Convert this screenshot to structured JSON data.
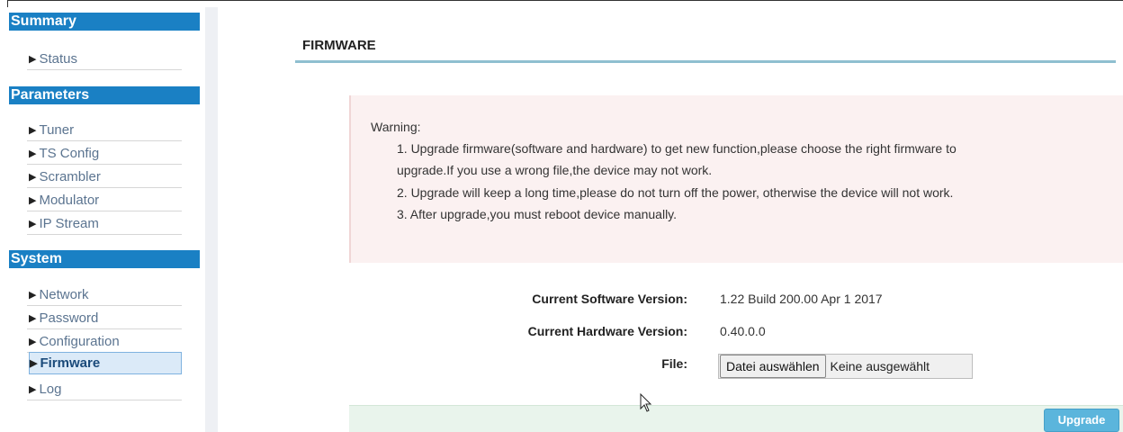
{
  "sidebar": {
    "sections": [
      {
        "title": "Summary",
        "items": [
          {
            "label": "Status"
          }
        ]
      },
      {
        "title": "Parameters",
        "items": [
          {
            "label": "Tuner"
          },
          {
            "label": "TS Config"
          },
          {
            "label": "Scrambler"
          },
          {
            "label": "Modulator"
          },
          {
            "label": "IP Stream"
          }
        ]
      },
      {
        "title": "System",
        "items": [
          {
            "label": "Network"
          },
          {
            "label": "Password"
          },
          {
            "label": "Configuration"
          },
          {
            "label": "Firmware",
            "active": true
          },
          {
            "label": "Log"
          }
        ]
      }
    ]
  },
  "main": {
    "title": "FIRMWARE",
    "warning": {
      "heading": "Warning:",
      "lines": [
        "1. Upgrade firmware(software and hardware) to get new function,please choose the right firmware to",
        "upgrade.If you use a wrong file,the device may not work.",
        "2. Upgrade will keep a long time,please do not turn off the power, otherwise the device will not work.",
        "3. After upgrade,you must reboot device manually."
      ]
    },
    "software_label": "Current Software Version:",
    "software_value": "1.22 Build 200.00 Apr 1 2017",
    "hardware_label": "Current Hardware Version:",
    "hardware_value": "0.40.0.0",
    "file_label": "File:",
    "file_button": "Datei auswählen",
    "file_status": "Keine ausgewählt",
    "upgrade_button": "Upgrade"
  }
}
